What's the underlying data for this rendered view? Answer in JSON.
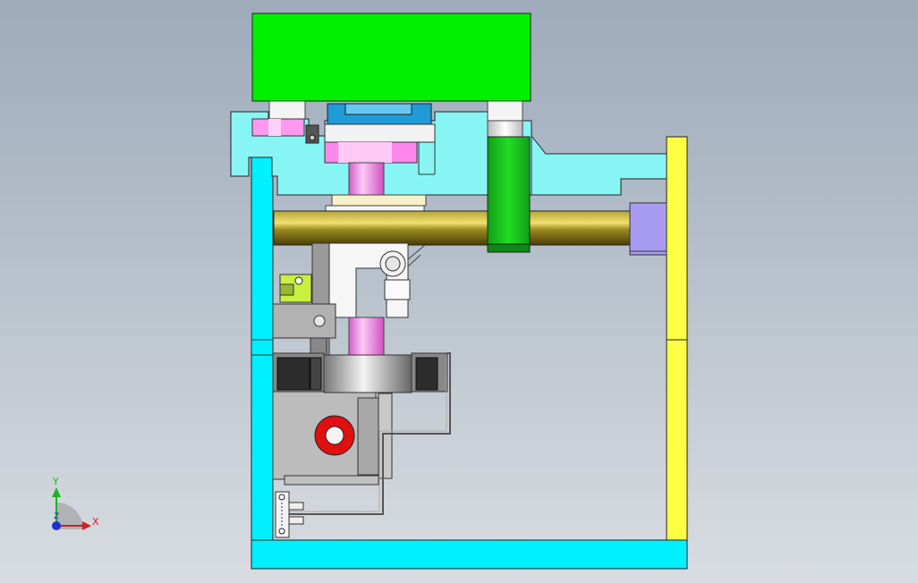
{
  "triad": {
    "x_label": "X",
    "y_label": "Y",
    "z_label": "Z"
  },
  "colors": {
    "background_top": "#9eabbb",
    "background_bottom": "#d9dde2",
    "top_block": "#00f000",
    "frame_cyan": "#00f0ff",
    "plate_light_cyan": "#88f5f5",
    "rail_yellow": "#ffff44",
    "shaft_olive": "#8a7a10",
    "piston_pink": "#ff88ee",
    "blue_clamp": "#1f9bd8",
    "lavender_block": "#a89cf2",
    "ring_red": "#e01010",
    "axis_x": "#d42020",
    "axis_y": "#20b020",
    "axis_z": "#2030d0"
  }
}
